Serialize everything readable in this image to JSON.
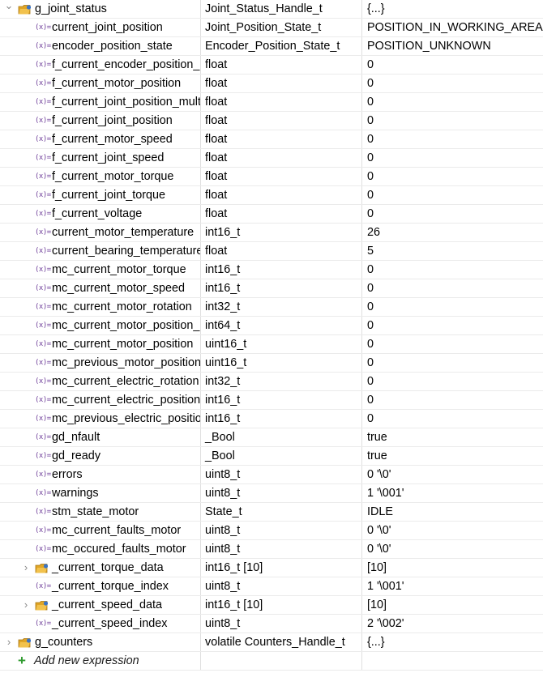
{
  "rows": [
    {
      "indent": 0,
      "expander": "v",
      "icon": "struct",
      "name": "g_joint_status",
      "type": "Joint_Status_Handle_t",
      "value": "{...}"
    },
    {
      "indent": 1,
      "icon": "var",
      "name": "current_joint_position",
      "type": "Joint_Position_State_t",
      "value": "POSITION_IN_WORKING_AREA"
    },
    {
      "indent": 1,
      "icon": "var",
      "name": "encoder_position_state",
      "type": "Encoder_Position_State_t",
      "value": "POSITION_UNKNOWN"
    },
    {
      "indent": 1,
      "icon": "var",
      "name": "f_current_encoder_position_offset",
      "type": "float",
      "value": "0"
    },
    {
      "indent": 1,
      "icon": "var",
      "name": "f_current_motor_position",
      "type": "float",
      "value": "0"
    },
    {
      "indent": 1,
      "icon": "var",
      "name": "f_current_joint_position_multiturn",
      "type": "float",
      "value": "0"
    },
    {
      "indent": 1,
      "icon": "var",
      "name": "f_current_joint_position",
      "type": "float",
      "value": "0"
    },
    {
      "indent": 1,
      "icon": "var",
      "name": "f_current_motor_speed",
      "type": "float",
      "value": "0"
    },
    {
      "indent": 1,
      "icon": "var",
      "name": "f_current_joint_speed",
      "type": "float",
      "value": "0"
    },
    {
      "indent": 1,
      "icon": "var",
      "name": "f_current_motor_torque",
      "type": "float",
      "value": "0"
    },
    {
      "indent": 1,
      "icon": "var",
      "name": "f_current_joint_torque",
      "type": "float",
      "value": "0"
    },
    {
      "indent": 1,
      "icon": "var",
      "name": "f_current_voltage",
      "type": "float",
      "value": "0"
    },
    {
      "indent": 1,
      "icon": "var",
      "name": "current_motor_temperature",
      "type": "int16_t",
      "value": "26"
    },
    {
      "indent": 1,
      "icon": "var",
      "name": "current_bearing_temperature",
      "type": "float",
      "value": "5"
    },
    {
      "indent": 1,
      "icon": "var",
      "name": "mc_current_motor_torque",
      "type": "int16_t",
      "value": "0"
    },
    {
      "indent": 1,
      "icon": "var",
      "name": "mc_current_motor_speed",
      "type": "int16_t",
      "value": "0"
    },
    {
      "indent": 1,
      "icon": "var",
      "name": "mc_current_motor_rotation",
      "type": "int32_t",
      "value": "0"
    },
    {
      "indent": 1,
      "icon": "var",
      "name": "mc_current_motor_position_",
      "type": "int64_t",
      "value": "0"
    },
    {
      "indent": 1,
      "icon": "var",
      "name": "mc_current_motor_position",
      "type": "uint16_t",
      "value": "0"
    },
    {
      "indent": 1,
      "icon": "var",
      "name": "mc_previous_motor_position",
      "type": "uint16_t",
      "value": "0"
    },
    {
      "indent": 1,
      "icon": "var",
      "name": "mc_current_electric_rotation",
      "type": "int32_t",
      "value": "0"
    },
    {
      "indent": 1,
      "icon": "var",
      "name": "mc_current_electric_position",
      "type": "int16_t",
      "value": "0"
    },
    {
      "indent": 1,
      "icon": "var",
      "name": "mc_previous_electric_position",
      "type": "int16_t",
      "value": "0"
    },
    {
      "indent": 1,
      "icon": "var",
      "name": "gd_nfault",
      "type": "_Bool",
      "value": "true"
    },
    {
      "indent": 1,
      "icon": "var",
      "name": "gd_ready",
      "type": "_Bool",
      "value": "true"
    },
    {
      "indent": 1,
      "icon": "var",
      "name": "errors",
      "type": "uint8_t",
      "value": "0 '\\0'"
    },
    {
      "indent": 1,
      "icon": "var",
      "name": "warnings",
      "type": "uint8_t",
      "value": "1 '\\001'"
    },
    {
      "indent": 1,
      "icon": "var",
      "name": "stm_state_motor",
      "type": "State_t",
      "value": "IDLE"
    },
    {
      "indent": 1,
      "icon": "var",
      "name": "mc_current_faults_motor",
      "type": "uint8_t",
      "value": "0 '\\0'"
    },
    {
      "indent": 1,
      "icon": "var",
      "name": "mc_occured_faults_motor",
      "type": "uint8_t",
      "value": "0 '\\0'"
    },
    {
      "indent": 1,
      "expander": ">",
      "icon": "struct",
      "name": "_current_torque_data",
      "type": "int16_t [10]",
      "value": "[10]"
    },
    {
      "indent": 1,
      "icon": "var",
      "name": "_current_torque_index",
      "type": "uint8_t",
      "value": "1 '\\001'"
    },
    {
      "indent": 1,
      "expander": ">",
      "icon": "struct",
      "name": "_current_speed_data",
      "type": "int16_t [10]",
      "value": "[10]"
    },
    {
      "indent": 1,
      "icon": "var",
      "name": "_current_speed_index",
      "type": "uint8_t",
      "value": "2 '\\002'"
    },
    {
      "indent": 0,
      "expander": ">",
      "icon": "struct",
      "name": "g_counters",
      "type": "volatile Counters_Handle_t",
      "value": "{...}"
    },
    {
      "indent": 0,
      "icon": "add",
      "name": "Add new expression",
      "type": "",
      "value": ""
    }
  ],
  "icons": {
    "var": "(x)=",
    "struct_color": "#e0a526",
    "struct_accent": "#3a73c4",
    "add": "+"
  }
}
